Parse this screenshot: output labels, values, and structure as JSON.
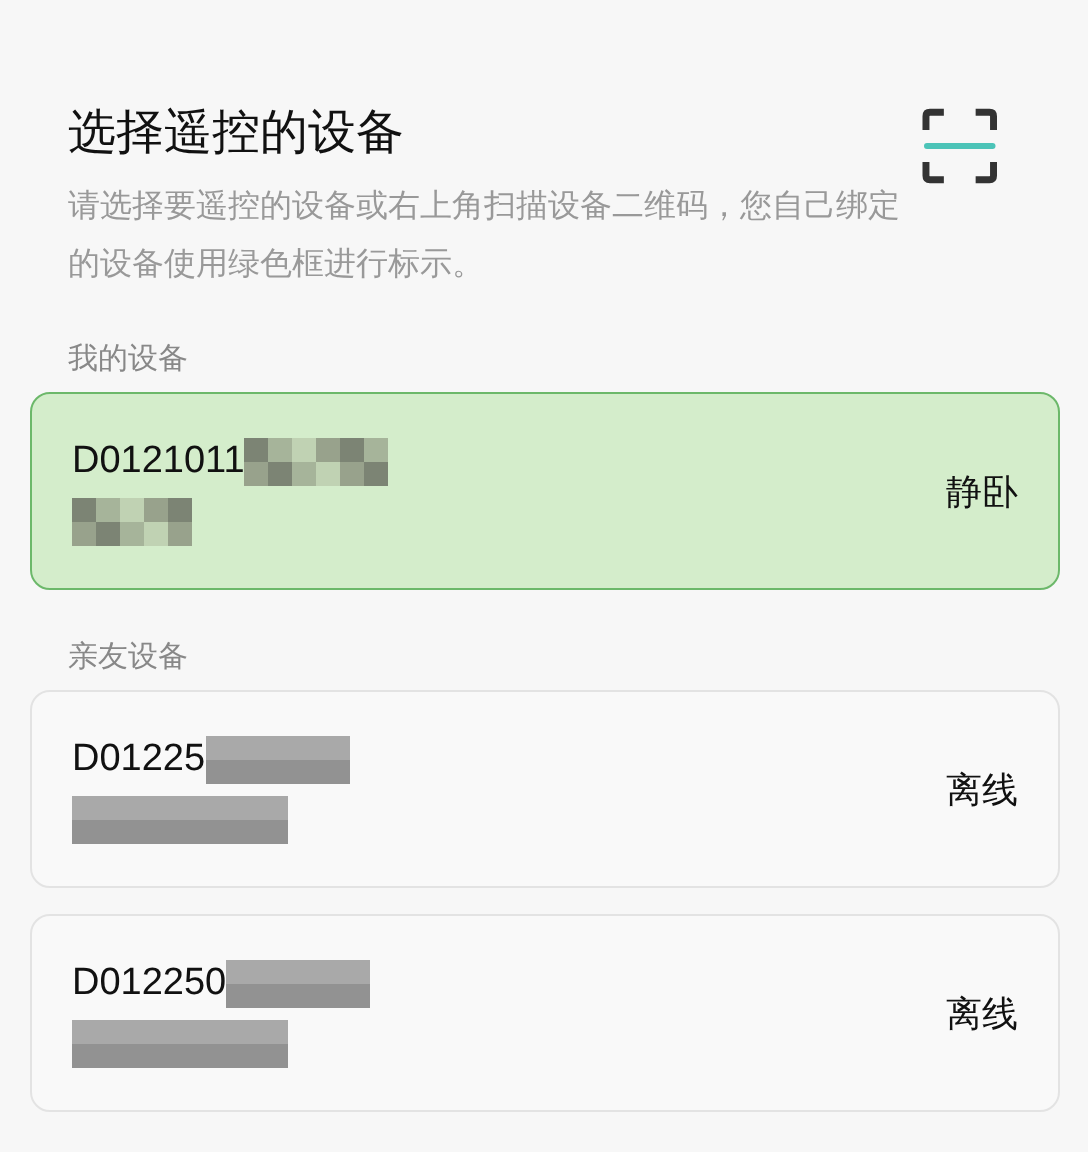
{
  "header": {
    "title": "选择遥控的设备",
    "description": "请选择要遥控的设备或右上角扫描设备二维码，您自己绑定的设备使用绿色框进行标示。"
  },
  "sections": [
    {
      "label": "我的设备",
      "devices": [
        {
          "id": "D0121011",
          "status": "静卧",
          "owned": true
        }
      ]
    },
    {
      "label": "亲友设备",
      "devices": [
        {
          "id": "D01225",
          "status": "离线",
          "owned": false
        },
        {
          "id": "D012250",
          "status": "离线",
          "owned": false
        }
      ]
    }
  ]
}
